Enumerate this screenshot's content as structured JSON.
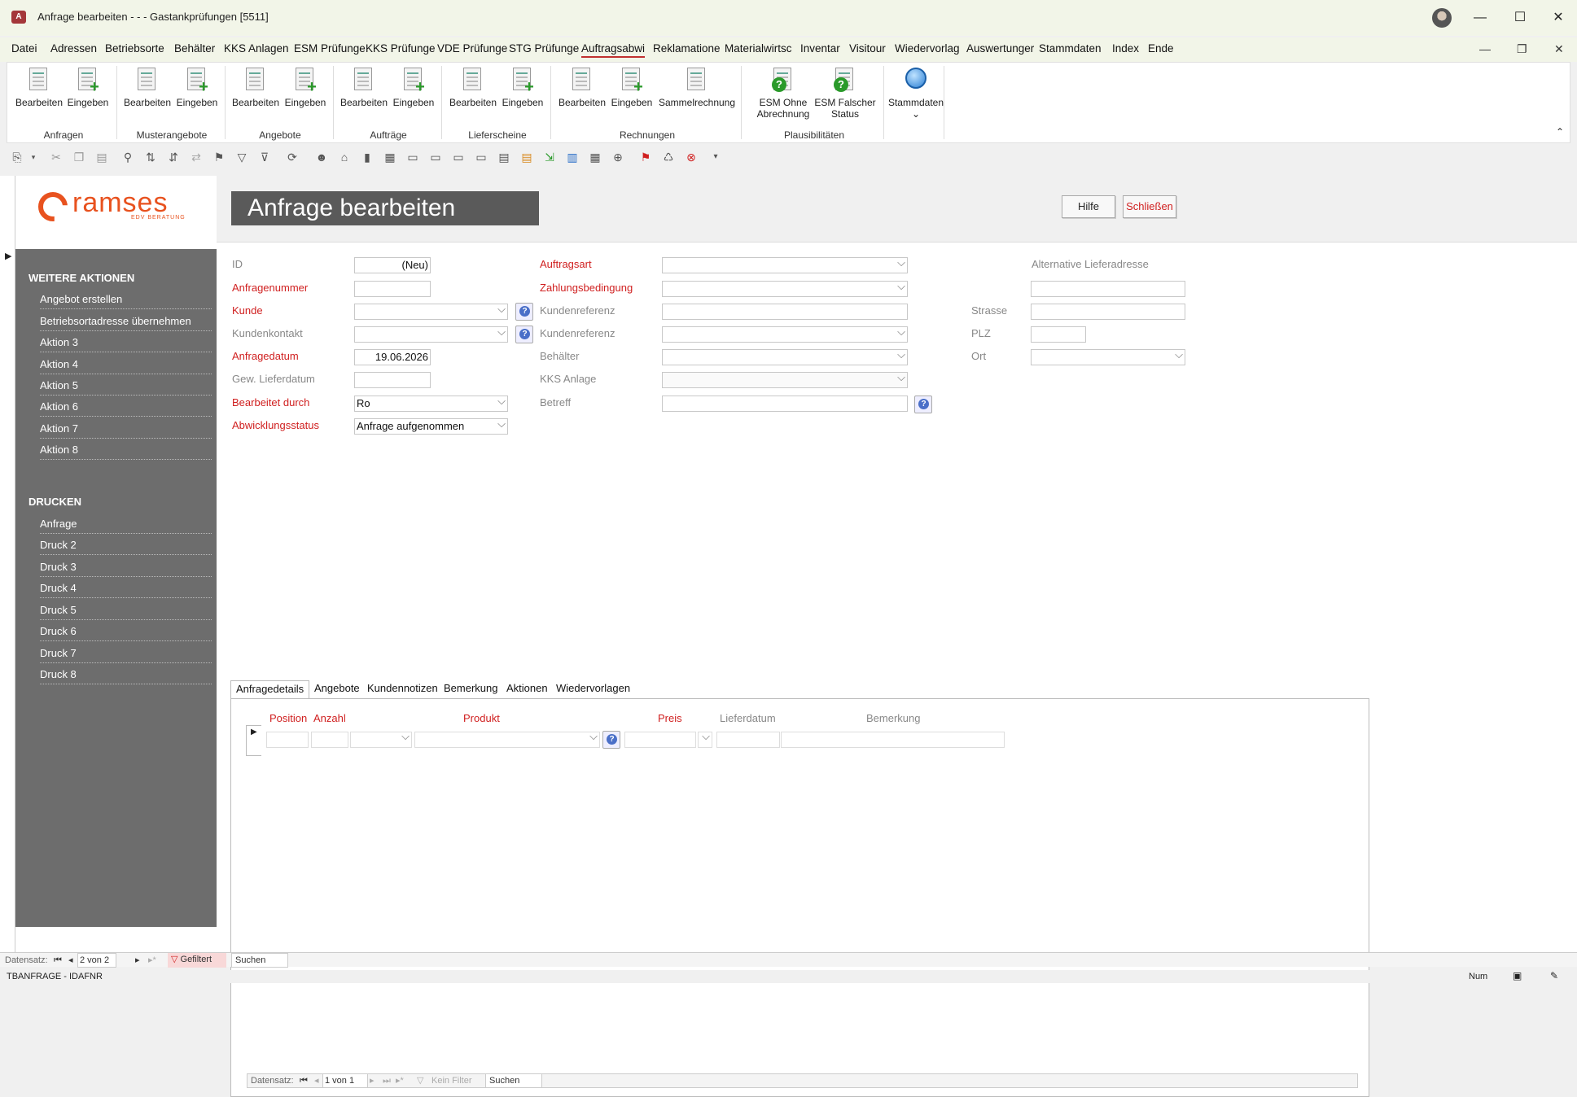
{
  "window": {
    "title": "Anfrage bearbeiten - -  - Gastankprüfungen [5511]",
    "app_icon": "A"
  },
  "menu": {
    "items": [
      "Datei",
      "Adressen",
      "Betriebsorte",
      "Behälter",
      "KKS Anlagen",
      "ESM Prüfunge",
      "KKS Prüfunge",
      "VDE Prüfunge",
      "STG Prüfunge",
      "Auftragsabwi",
      "Reklamatione",
      "Materialwirtsc",
      "Inventar",
      "Visitour",
      "Wiedervorlag",
      "Auswertunger",
      "Stammdaten",
      "Index",
      "Ende"
    ],
    "active": "Auftragsabwi"
  },
  "ribbon": {
    "groups": [
      {
        "label": "Anfragen",
        "buttons": [
          "Bearbeiten",
          "Eingeben"
        ]
      },
      {
        "label": "Musterangebote",
        "buttons": [
          "Bearbeiten",
          "Eingeben"
        ]
      },
      {
        "label": "Angebote",
        "buttons": [
          "Bearbeiten",
          "Eingeben"
        ]
      },
      {
        "label": "Aufträge",
        "buttons": [
          "Bearbeiten",
          "Eingeben"
        ]
      },
      {
        "label": "Lieferscheine",
        "buttons": [
          "Bearbeiten",
          "Eingeben"
        ]
      },
      {
        "label": "Rechnungen",
        "buttons": [
          "Bearbeiten",
          "Eingeben",
          "Sammelrechnung"
        ]
      },
      {
        "label": "Plausibilitäten",
        "buttons": [
          "ESM Ohne Abrechnung",
          "ESM Falscher Status"
        ]
      }
    ],
    "stammdaten": "Stammdaten"
  },
  "logo": {
    "name": "ramses",
    "sub": "EDV BERATUNG",
    "accent": "#e8521f"
  },
  "nav": {
    "weitere_title": "WEITERE AKTIONEN",
    "weitere": [
      "Angebot erstellen",
      "Betriebsortadresse übernehmen",
      "Aktion 3",
      "Aktion 4",
      "Aktion 5",
      "Aktion 6",
      "Aktion 7",
      "Aktion 8"
    ],
    "drucken_title": "DRUCKEN",
    "drucken": [
      "Anfrage",
      "Druck 2",
      "Druck 3",
      "Druck 4",
      "Druck 5",
      "Druck 6",
      "Druck 7",
      "Druck 8"
    ]
  },
  "header": {
    "title": "Anfrage bearbeiten",
    "help": "Hilfe",
    "close": "Schließen"
  },
  "form": {
    "id_label": "ID",
    "id_value": "(Neu)",
    "anfragenummer": "Anfragenummer",
    "kunde": "Kunde",
    "kundenkontakt": "Kundenkontakt",
    "anfragedatum": "Anfragedatum",
    "anfragedatum_value": "19.06.2026",
    "lieferdatum": "Gew. Lieferdatum",
    "bearbeitet": "Bearbeitet durch",
    "bearbeitet_value": "Ro",
    "status": "Abwicklungsstatus",
    "status_value": "Anfrage aufgenommen",
    "auftragsart": "Auftragsart",
    "zahlung": "Zahlungsbedingung",
    "kundenref1": "Kundenreferenz",
    "kundenref2": "Kundenreferenz",
    "behaelter": "Behälter",
    "kks": "KKS Anlage",
    "betreff": "Betreff",
    "alt_title": "Alternative Lieferadresse",
    "strasse": "Strasse",
    "plz": "PLZ",
    "ort": "Ort"
  },
  "tabs": [
    "Anfragedetails",
    "Angebote",
    "Kundennotizen",
    "Bemerkung",
    "Aktionen",
    "Wiedervorlagen"
  ],
  "subform": {
    "columns": [
      "Position",
      "Anzahl",
      "Produkt",
      "Preis",
      "Lieferdatum",
      "Bemerkung"
    ],
    "recnav_label": "Datensatz:",
    "recnav_value": "1 von 1",
    "filter": "Kein Filter",
    "search": "Suchen"
  },
  "mainnav": {
    "label": "Datensatz:",
    "value": "2 von 2",
    "filter": "Gefiltert",
    "search": "Suchen"
  },
  "statusbar": {
    "left": "TBANFRAGE - IDAFNR",
    "num": "Num"
  }
}
